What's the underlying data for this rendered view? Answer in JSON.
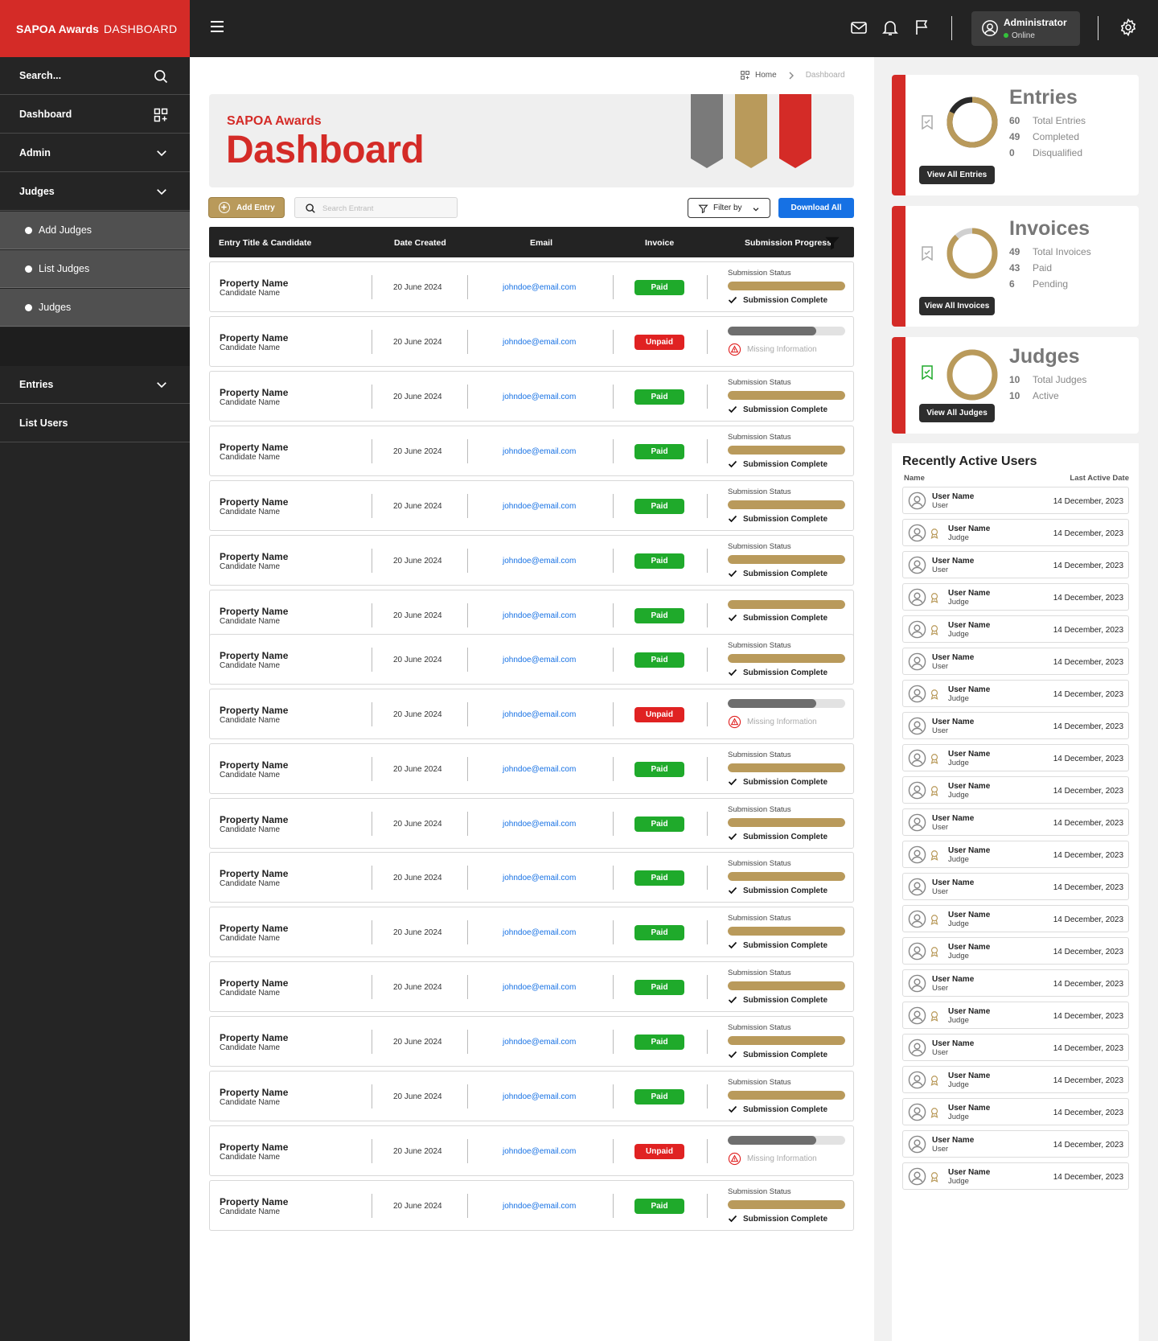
{
  "brand": {
    "bold": "SAPOA Awards",
    "light": "DASHBOARD"
  },
  "header": {
    "user_name": "Administrator",
    "user_status": "Online"
  },
  "sidebar": {
    "search_label": "Search...",
    "items": [
      {
        "label": "Dashboard"
      },
      {
        "label": "Admin"
      },
      {
        "label": "Judges"
      },
      {
        "label": "Add Judges"
      },
      {
        "label": "List Judges"
      },
      {
        "label": "Judges"
      },
      {
        "label": "Entries"
      },
      {
        "label": "List Users"
      }
    ]
  },
  "breadcrumb": {
    "home": "Home",
    "current": "Dashboard"
  },
  "hero": {
    "subtitle": "SAPOA Awards",
    "title": "Dashboard"
  },
  "ribbon_colors": [
    "#7a7a7a",
    "#b99a5b",
    "#d42b27"
  ],
  "toolbar": {
    "add_entry": "Add Entry",
    "search_placeholder": "Search Entrant",
    "filter": "Filter by",
    "download": "Download All"
  },
  "table": {
    "headers": [
      "Entry Title  & Candidate",
      "Date Created",
      "Email",
      "Invoice",
      "Submission Progress"
    ],
    "rows": [
      {
        "property": "Property Name",
        "candidate": "Candidate Name",
        "date": "20 June 2024",
        "email": "johndoe@email.com",
        "invoice": "Paid",
        "status_label": "Submission Status",
        "status": "Submission Complete",
        "progress": 1.0
      },
      {
        "property": "Property Name",
        "candidate": "Candidate Name",
        "date": "20 June 2024",
        "email": "johndoe@email.com",
        "invoice": "Unpaid",
        "status_label": "",
        "status": "Missing Information",
        "progress": 0.75
      },
      {
        "property": "Property Name",
        "candidate": "Candidate Name",
        "date": "20 June 2024",
        "email": "johndoe@email.com",
        "invoice": "Paid",
        "status_label": "Submission Status",
        "status": "Submission Complete",
        "progress": 1.0
      },
      {
        "property": "Property Name",
        "candidate": "Candidate Name",
        "date": "20 June 2024",
        "email": "johndoe@email.com",
        "invoice": "Paid",
        "status_label": "Submission Status",
        "status": "Submission Complete",
        "progress": 1.0
      },
      {
        "property": "Property Name",
        "candidate": "Candidate Name",
        "date": "20 June 2024",
        "email": "johndoe@email.com",
        "invoice": "Paid",
        "status_label": "Submission Status",
        "status": "Submission Complete",
        "progress": 1.0
      },
      {
        "property": "Property Name",
        "candidate": "Candidate Name",
        "date": "20 June 2024",
        "email": "johndoe@email.com",
        "invoice": "Paid",
        "status_label": "Submission Status",
        "status": "Submission Complete",
        "progress": 1.0
      },
      {
        "property": "Property Name",
        "candidate": "Candidate Name",
        "date": "20 June 2024",
        "email": "johndoe@email.com",
        "invoice": "Paid",
        "status_label": "",
        "status": "Submission Complete",
        "progress": 1.0
      },
      {
        "property": "Property Name",
        "candidate": "Candidate Name",
        "date": "20 June 2024",
        "email": "johndoe@email.com",
        "invoice": "Paid",
        "status_label": "Submission Status",
        "status": "Submission Complete",
        "progress": 1.0
      },
      {
        "property": "Property Name",
        "candidate": "Candidate Name",
        "date": "20 June 2024",
        "email": "johndoe@email.com",
        "invoice": "Unpaid",
        "status_label": "",
        "status": "Missing Information",
        "progress": 0.75
      },
      {
        "property": "Property Name",
        "candidate": "Candidate Name",
        "date": "20 June 2024",
        "email": "johndoe@email.com",
        "invoice": "Paid",
        "status_label": "Submission Status",
        "status": "Submission Complete",
        "progress": 1.0
      },
      {
        "property": "Property Name",
        "candidate": "Candidate Name",
        "date": "20 June 2024",
        "email": "johndoe@email.com",
        "invoice": "Paid",
        "status_label": "Submission Status",
        "status": "Submission Complete",
        "progress": 1.0
      },
      {
        "property": "Property Name",
        "candidate": "Candidate Name",
        "date": "20 June 2024",
        "email": "johndoe@email.com",
        "invoice": "Paid",
        "status_label": "Submission Status",
        "status": "Submission Complete",
        "progress": 1.0
      },
      {
        "property": "Property Name",
        "candidate": "Candidate Name",
        "date": "20 June 2024",
        "email": "johndoe@email.com",
        "invoice": "Paid",
        "status_label": "Submission Status",
        "status": "Submission Complete",
        "progress": 1.0
      },
      {
        "property": "Property Name",
        "candidate": "Candidate Name",
        "date": "20 June 2024",
        "email": "johndoe@email.com",
        "invoice": "Paid",
        "status_label": "Submission Status",
        "status": "Submission Complete",
        "progress": 1.0
      },
      {
        "property": "Property Name",
        "candidate": "Candidate Name",
        "date": "20 June 2024",
        "email": "johndoe@email.com",
        "invoice": "Paid",
        "status_label": "Submission Status",
        "status": "Submission Complete",
        "progress": 1.0
      },
      {
        "property": "Property Name",
        "candidate": "Candidate Name",
        "date": "20 June 2024",
        "email": "johndoe@email.com",
        "invoice": "Paid",
        "status_label": "Submission Status",
        "status": "Submission Complete",
        "progress": 1.0
      },
      {
        "property": "Property Name",
        "candidate": "Candidate Name",
        "date": "20 June 2024",
        "email": "johndoe@email.com",
        "invoice": "Unpaid",
        "status_label": "",
        "status": "Missing Information",
        "progress": 0.75
      },
      {
        "property": "Property Name",
        "candidate": "Candidate Name",
        "date": "20 June 2024",
        "email": "johndoe@email.com",
        "invoice": "Paid",
        "status_label": "Submission Status",
        "status": "Submission Complete",
        "progress": 1.0
      }
    ]
  },
  "stats": [
    {
      "title": "Entries",
      "button": "View All Entries",
      "lines": [
        {
          "n": "60",
          "l": "Total Entries"
        },
        {
          "n": "49",
          "l": "Completed"
        },
        {
          "n": "0",
          "l": "Disqualified"
        }
      ],
      "fraction": 0.82
    },
    {
      "title": "Invoices",
      "button": "View All Invoices",
      "lines": [
        {
          "n": "49",
          "l": "Total Invoices"
        },
        {
          "n": "43",
          "l": "Paid"
        },
        {
          "n": "6",
          "l": "Pending"
        }
      ],
      "fraction": 0.88
    },
    {
      "title": "Judges",
      "button": "View All Judges",
      "lines": [
        {
          "n": "10",
          "l": "Total Judges"
        },
        {
          "n": "10",
          "l": "Active"
        }
      ],
      "fraction": 1.0
    }
  ],
  "recent": {
    "title": "Recently Active Users",
    "col_name": "Name",
    "col_date": "Last Active Date",
    "users": [
      {
        "name": "User Name",
        "role": "User",
        "date": "14 December, 2023"
      },
      {
        "name": "User Name",
        "role": "Judge",
        "date": "14 December, 2023"
      },
      {
        "name": "User Name",
        "role": "User",
        "date": "14 December, 2023"
      },
      {
        "name": "User Name",
        "role": "Judge",
        "date": "14 December, 2023"
      },
      {
        "name": "User Name",
        "role": "Judge",
        "date": "14 December, 2023"
      },
      {
        "name": "User Name",
        "role": "User",
        "date": "14 December, 2023"
      },
      {
        "name": "User Name",
        "role": "Judge",
        "date": "14 December, 2023"
      },
      {
        "name": "User Name",
        "role": "User",
        "date": "14 December, 2023"
      },
      {
        "name": "User Name",
        "role": "Judge",
        "date": "14 December, 2023"
      },
      {
        "name": "User Name",
        "role": "Judge",
        "date": "14 December, 2023"
      },
      {
        "name": "User Name",
        "role": "User",
        "date": "14 December, 2023"
      },
      {
        "name": "User Name",
        "role": "Judge",
        "date": "14 December, 2023"
      },
      {
        "name": "User Name",
        "role": "User",
        "date": "14 December, 2023"
      },
      {
        "name": "User Name",
        "role": "Judge",
        "date": "14 December, 2023"
      },
      {
        "name": "User Name",
        "role": "Judge",
        "date": "14 December, 2023"
      },
      {
        "name": "User Name",
        "role": "User",
        "date": "14 December, 2023"
      },
      {
        "name": "User Name",
        "role": "Judge",
        "date": "14 December, 2023"
      },
      {
        "name": "User Name",
        "role": "User",
        "date": "14 December, 2023"
      },
      {
        "name": "User Name",
        "role": "Judge",
        "date": "14 December, 2023"
      },
      {
        "name": "User Name",
        "role": "Judge",
        "date": "14 December, 2023"
      },
      {
        "name": "User Name",
        "role": "User",
        "date": "14 December, 2023"
      },
      {
        "name": "User Name",
        "role": "Judge",
        "date": "14 December, 2023"
      }
    ]
  },
  "colors": {
    "brand_red": "#d42b27",
    "gold": "#b99a5b",
    "paid": "#1faa2b",
    "unpaid": "#e02222",
    "link": "#1671e4"
  }
}
